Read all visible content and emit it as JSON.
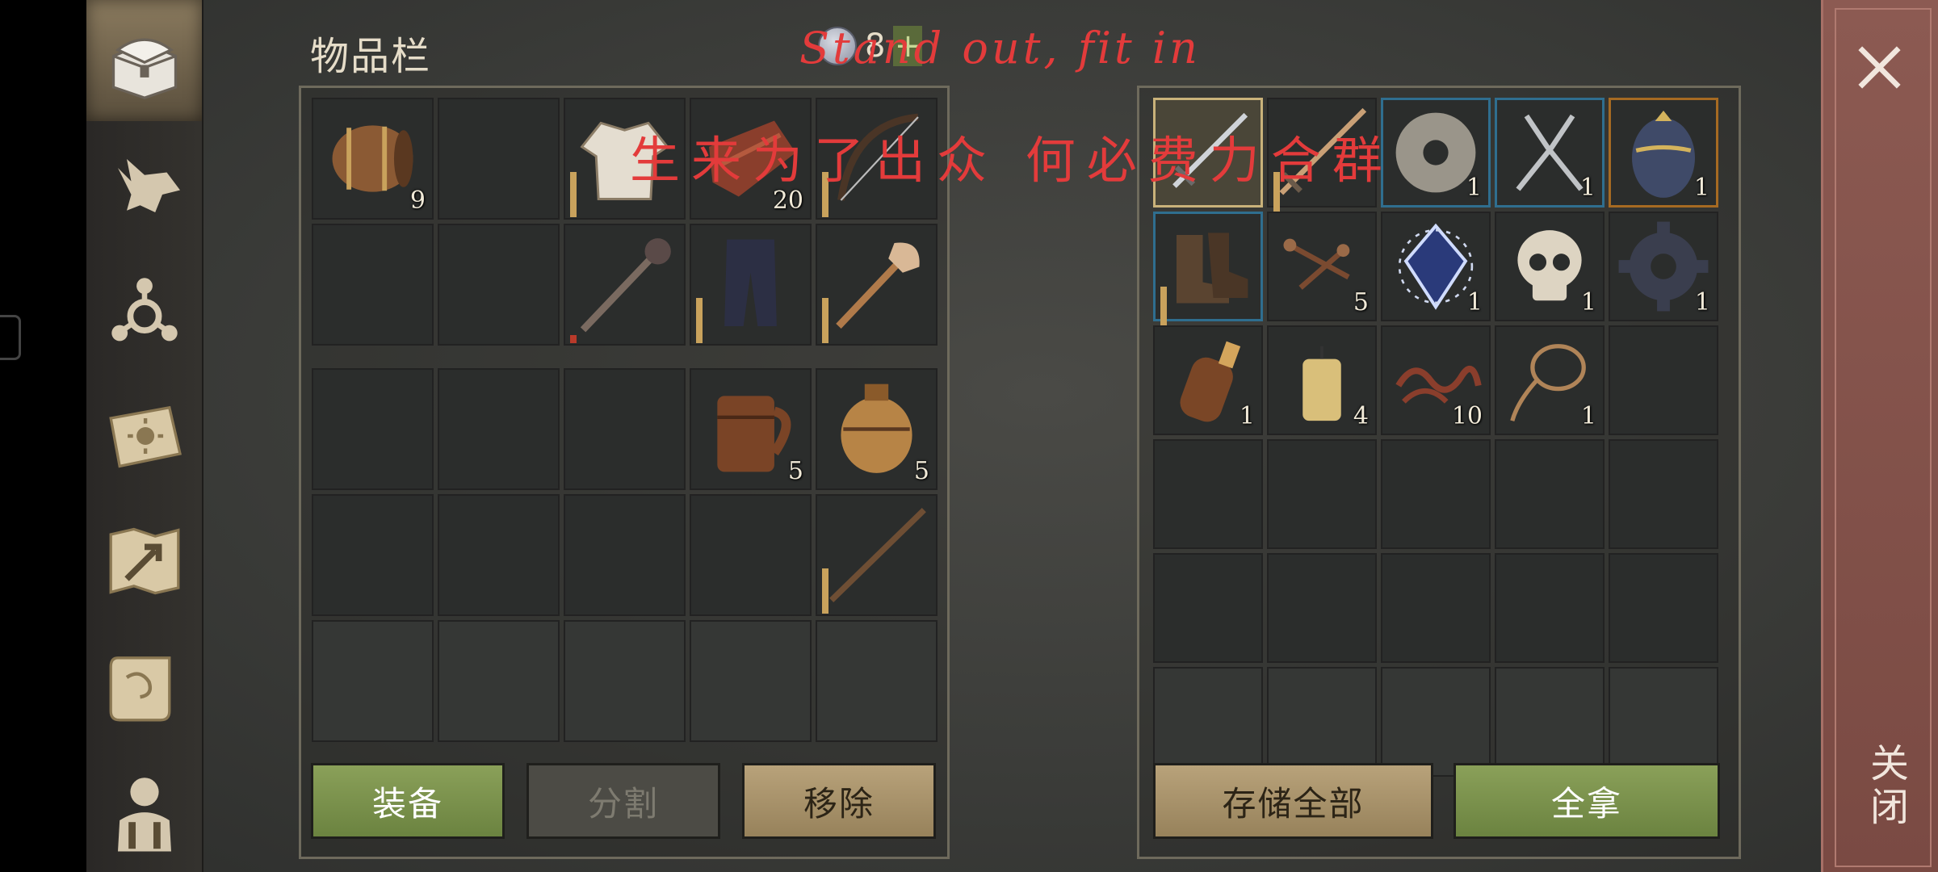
{
  "header": {
    "title": "物品栏",
    "currency_value": "8",
    "currency_plus": "+"
  },
  "watermark": {
    "english": "Stand out, fit in",
    "chinese": "生来为了出众 何必费力合群"
  },
  "sidebar": {
    "items": [
      {
        "icon": "chest-icon",
        "active": true
      },
      {
        "icon": "wolf-icon",
        "active": false
      },
      {
        "icon": "skill-tree-icon",
        "active": false
      },
      {
        "icon": "sun-book-icon",
        "active": false
      },
      {
        "icon": "map-icon",
        "active": false
      },
      {
        "icon": "scroll-icon",
        "active": false
      },
      {
        "icon": "character-icon",
        "active": false
      }
    ]
  },
  "inventory": {
    "upper": [
      {
        "icon": "barrel-icon",
        "qty": "9"
      },
      {
        "icon": "",
        "qty": ""
      },
      {
        "icon": "shirt-icon",
        "qty": "",
        "dur": true
      },
      {
        "icon": "leather-icon",
        "qty": "20"
      },
      {
        "icon": "bow-icon",
        "qty": "",
        "dur": true
      },
      {
        "icon": "",
        "qty": ""
      },
      {
        "icon": "",
        "qty": ""
      },
      {
        "icon": "mace-icon",
        "qty": "",
        "dur": true,
        "dur_low": true
      },
      {
        "icon": "pants-icon",
        "qty": "",
        "dur": true
      },
      {
        "icon": "shovel-icon",
        "qty": "",
        "dur": true
      }
    ],
    "lower": [
      {
        "icon": "",
        "qty": ""
      },
      {
        "icon": "",
        "qty": ""
      },
      {
        "icon": "",
        "qty": ""
      },
      {
        "icon": "mug-icon",
        "qty": "5"
      },
      {
        "icon": "keg-icon",
        "qty": "5"
      },
      {
        "icon": "",
        "qty": ""
      },
      {
        "icon": "",
        "qty": ""
      },
      {
        "icon": "",
        "qty": ""
      },
      {
        "icon": "",
        "qty": ""
      },
      {
        "icon": "stick-icon",
        "qty": "",
        "dur": true
      },
      {
        "icon": "",
        "qty": "",
        "faded": true
      },
      {
        "icon": "",
        "qty": "",
        "faded": true
      },
      {
        "icon": "",
        "qty": "",
        "faded": true
      },
      {
        "icon": "",
        "qty": "",
        "faded": true
      },
      {
        "icon": "",
        "qty": "",
        "faded": true
      }
    ]
  },
  "storage": {
    "cells": [
      {
        "icon": "sword-icon",
        "qty": "",
        "sel": "gold"
      },
      {
        "icon": "longsword-icon",
        "qty": "",
        "dur": true
      },
      {
        "icon": "whetstone-icon",
        "qty": "1",
        "sel": "blue"
      },
      {
        "icon": "pliers-icon",
        "qty": "1",
        "sel": "blue"
      },
      {
        "icon": "egg-icon",
        "qty": "1",
        "sel": "orange"
      },
      {
        "icon": "boots-icon",
        "qty": "",
        "sel": "blue",
        "dur": true
      },
      {
        "icon": "nails-icon",
        "qty": "5"
      },
      {
        "icon": "crystal-icon",
        "qty": "1"
      },
      {
        "icon": "skull-icon",
        "qty": "1"
      },
      {
        "icon": "gear-icon",
        "qty": "1"
      },
      {
        "icon": "bottle-icon",
        "qty": "1"
      },
      {
        "icon": "candle-icon",
        "qty": "4"
      },
      {
        "icon": "rope-icon",
        "qty": "10"
      },
      {
        "icon": "lasso-icon",
        "qty": "1"
      },
      {
        "icon": "",
        "qty": ""
      },
      {
        "icon": "",
        "qty": ""
      },
      {
        "icon": "",
        "qty": ""
      },
      {
        "icon": "",
        "qty": ""
      },
      {
        "icon": "",
        "qty": ""
      },
      {
        "icon": "",
        "qty": ""
      },
      {
        "icon": "",
        "qty": ""
      },
      {
        "icon": "",
        "qty": ""
      },
      {
        "icon": "",
        "qty": ""
      },
      {
        "icon": "",
        "qty": ""
      },
      {
        "icon": "",
        "qty": ""
      },
      {
        "icon": "",
        "qty": "",
        "faded": true
      },
      {
        "icon": "",
        "qty": "",
        "faded": true
      },
      {
        "icon": "",
        "qty": "",
        "faded": true
      },
      {
        "icon": "",
        "qty": "",
        "faded": true
      },
      {
        "icon": "",
        "qty": "",
        "faded": true
      }
    ]
  },
  "buttons": {
    "equip": "装备",
    "split": "分割",
    "remove": "移除",
    "store_all": "存储全部",
    "take_all": "全拿"
  },
  "close": {
    "label": "关闭"
  }
}
